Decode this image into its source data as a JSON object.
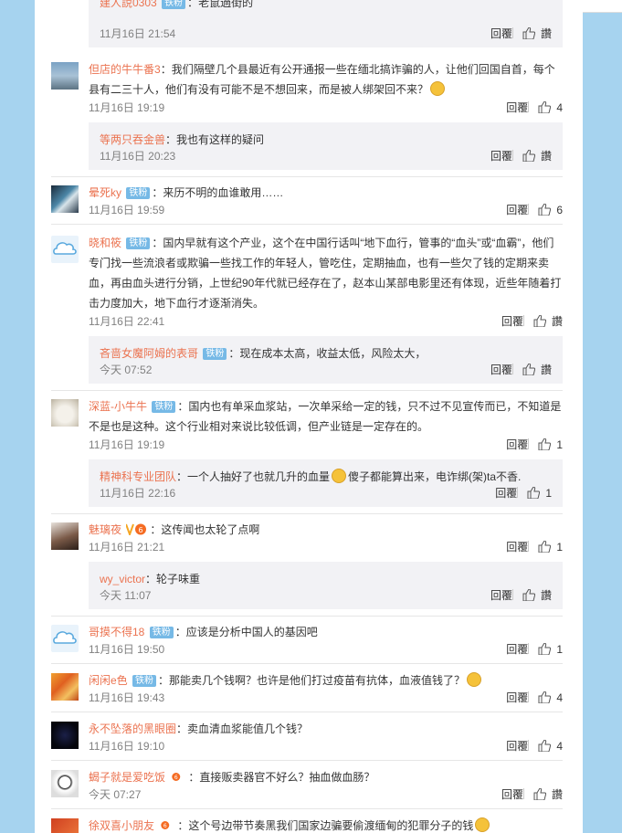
{
  "labels": {
    "reply": "回覆",
    "like": "讚"
  },
  "colors": {
    "username": "#eb7350",
    "badge": "#76b9e6",
    "sidebar": "#a6d3ef",
    "reply_bg": "#f2f2f5"
  },
  "comments": [
    {
      "user": "建人說0303",
      "badge": "铁粉",
      "text": "老鼠過街的",
      "time": "11月16日 21:54",
      "likes": "讚"
    },
    {
      "user": "但店的牛牛番3",
      "text": "我们隔壁几个县最近有公开通报一些在缅北搞诈骗的人，让他们回国自首，每个县有二三十人，他们有没有可能不是不想回来，而是被人绑架回不来？",
      "time": "11月16日 19:19",
      "likes": "4"
    },
    {
      "user": "等两只吞金兽",
      "text": "我也有这样的疑问",
      "time": "11月16日 20:23",
      "likes": "讚"
    },
    {
      "user": "晕死ky",
      "badge": "铁粉",
      "text": "来历不明的血谁敢用……",
      "time": "11月16日 19:59",
      "likes": "6"
    },
    {
      "user": "晓和筱",
      "badge": "铁粉",
      "text": "国内早就有这个产业，这个在中国行话叫“地下血行，管事的“血头”或“血霸”，他们专门找一些流浪者或欺骗一些找工作的年轻人，管吃住，定期抽血，也有一些欠了钱的定期来卖血，再由血头进行分销，上世纪90年代就已经存在了，赵本山某部电影里还有体现，近些年随着打击力度加大，地下血行才逐渐消失。",
      "time": "11月16日 22:41",
      "likes": "讚"
    },
    {
      "user": "吝啬女魔阿姆的表哥",
      "badge": "铁粉",
      "text": "现在成本太高，收益太低，风险太大，",
      "time": "今天 07:52",
      "likes": "讚"
    },
    {
      "user": "深蓝-小牛牛",
      "badge": "铁粉",
      "text": "国内也有单采血浆站，一次单采给一定的钱，只不过不见宣传而已，不知道是不是也是这种。这个行业相对来说比较低调，但产业链是一定存在的。",
      "time": "11月16日 19:19",
      "likes": "1"
    },
    {
      "user": "精神科专业团队",
      "text": "一个人抽好了也就几升的血量",
      "text2": "傻子都能算出来，电诈绑(架)ta不香.",
      "time": "11月16日 22:16",
      "likes": "1"
    },
    {
      "user": "魅璃夜",
      "text": "这传闻也太轮了点啊",
      "time": "11月16日 21:21",
      "likes": "1"
    },
    {
      "user": "wy_victor",
      "text": "轮子味重",
      "time": "今天 11:07",
      "likes": "讚"
    },
    {
      "user": "哥摸不得18",
      "badge": "铁粉",
      "text": "应该是分析中国人的基因吧",
      "time": "11月16日 19:50",
      "likes": "1"
    },
    {
      "user": "闲闲e色",
      "badge": "铁粉",
      "text": "那能卖几个钱啊？也许是他们打过疫苗有抗体，血液值钱了？",
      "time": "11月16日 19:43",
      "likes": "4"
    },
    {
      "user": "永不坠落的黑眼圈",
      "text": "卖血清血浆能值几个钱？",
      "time": "11月16日 19:10",
      "likes": "4"
    },
    {
      "user": "蝎子就是爱吃饭",
      "text": "直接贩卖器官不好么？抽血做血肠？",
      "time": "今天 07:27",
      "likes": "讚"
    },
    {
      "user": "徐双喜小朋友",
      "text": "这个号边带节奏黑我们国家边骗要偷渡缅甸的犯罪分子的钱"
    }
  ]
}
